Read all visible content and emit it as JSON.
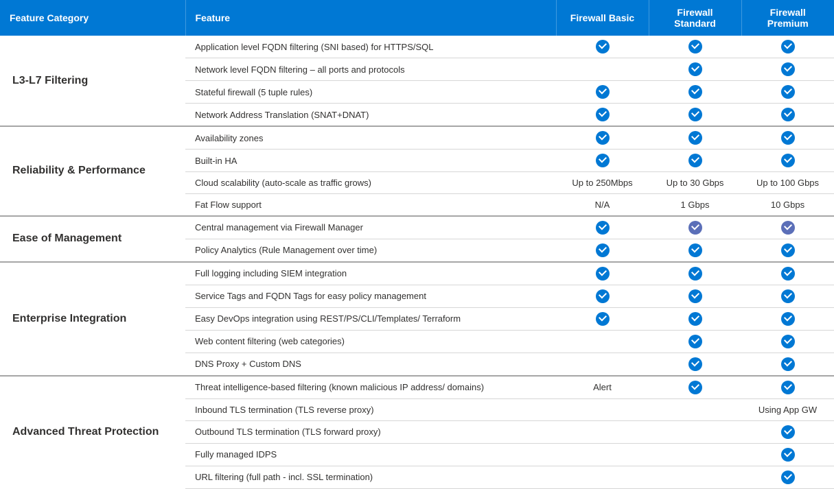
{
  "headers": {
    "category": "Feature Category",
    "feature": "Feature",
    "tiers": [
      "Firewall Basic",
      "Firewall Standard",
      "Firewall Premium"
    ]
  },
  "groups": [
    {
      "category": "L3-L7 Filtering",
      "rows": [
        {
          "feature": "Application level FQDN filtering (SNI based) for HTTPS/SQL",
          "cells": [
            {
              "t": "check"
            },
            {
              "t": "check"
            },
            {
              "t": "check"
            }
          ]
        },
        {
          "feature": "Network level FQDN filtering – all ports and protocols",
          "cells": [
            {
              "t": "blank"
            },
            {
              "t": "check"
            },
            {
              "t": "check"
            }
          ]
        },
        {
          "feature": "Stateful firewall (5 tuple rules)",
          "cells": [
            {
              "t": "check"
            },
            {
              "t": "check"
            },
            {
              "t": "check"
            }
          ]
        },
        {
          "feature": "Network Address Translation (SNAT+DNAT)",
          "cells": [
            {
              "t": "check"
            },
            {
              "t": "check"
            },
            {
              "t": "check"
            }
          ]
        }
      ]
    },
    {
      "category": "Reliability & Performance",
      "rows": [
        {
          "feature": "Availability zones",
          "cells": [
            {
              "t": "check"
            },
            {
              "t": "check"
            },
            {
              "t": "check"
            }
          ]
        },
        {
          "feature": "Built-in  HA",
          "cells": [
            {
              "t": "check"
            },
            {
              "t": "check"
            },
            {
              "t": "check"
            }
          ]
        },
        {
          "feature": "Cloud scalability (auto-scale as traffic grows)",
          "cells": [
            {
              "t": "text",
              "v": "Up to 250Mbps"
            },
            {
              "t": "text",
              "v": "Up to 30 Gbps"
            },
            {
              "t": "text",
              "v": "Up to 100 Gbps"
            }
          ]
        },
        {
          "feature": " Fat Flow support",
          "cells": [
            {
              "t": "text",
              "v": "N/A"
            },
            {
              "t": "text",
              "v": "1 Gbps"
            },
            {
              "t": "text",
              "v": "10 Gbps"
            }
          ]
        }
      ]
    },
    {
      "category": "Ease of Management",
      "rows": [
        {
          "feature": "Central management via Firewall Manager",
          "cells": [
            {
              "t": "check"
            },
            {
              "t": "check-muted"
            },
            {
              "t": "check-muted"
            }
          ]
        },
        {
          "feature": "Policy Analytics  (Rule Management over time)",
          "cells": [
            {
              "t": "check"
            },
            {
              "t": "check"
            },
            {
              "t": "check"
            }
          ]
        }
      ]
    },
    {
      "category": "Enterprise Integration",
      "rows": [
        {
          "feature": "Full logging including SIEM integration",
          "cells": [
            {
              "t": "check"
            },
            {
              "t": "check"
            },
            {
              "t": "check"
            }
          ]
        },
        {
          "feature": "Service Tags and FQDN Tags for easy policy management",
          "cells": [
            {
              "t": "check"
            },
            {
              "t": "check"
            },
            {
              "t": "check"
            }
          ]
        },
        {
          "feature": "Easy DevOps integration using REST/PS/CLI/Templates/ Terraform",
          "cells": [
            {
              "t": "check"
            },
            {
              "t": "check"
            },
            {
              "t": "check"
            }
          ]
        },
        {
          "feature": "Web content filtering (web categories)",
          "cells": [
            {
              "t": "blank"
            },
            {
              "t": "check"
            },
            {
              "t": "check"
            }
          ]
        },
        {
          "feature": "DNS Proxy + Custom DNS",
          "cells": [
            {
              "t": "blank"
            },
            {
              "t": "check"
            },
            {
              "t": "check"
            }
          ]
        }
      ]
    },
    {
      "category": "Advanced Threat Protection",
      "rows": [
        {
          "feature": "Threat intelligence-based filtering (known malicious IP address/ domains)",
          "cells": [
            {
              "t": "text",
              "v": "Alert"
            },
            {
              "t": "check"
            },
            {
              "t": "check"
            }
          ]
        },
        {
          "feature": "Inbound TLS termination (TLS reverse proxy)",
          "cells": [
            {
              "t": "blank"
            },
            {
              "t": "blank"
            },
            {
              "t": "text",
              "v": "Using App GW"
            }
          ]
        },
        {
          "feature": "Outbound TLS termination (TLS forward proxy)",
          "cells": [
            {
              "t": "blank"
            },
            {
              "t": "blank"
            },
            {
              "t": "check"
            }
          ]
        },
        {
          "feature": "Fully managed IDPS",
          "cells": [
            {
              "t": "blank"
            },
            {
              "t": "blank"
            },
            {
              "t": "check"
            }
          ]
        },
        {
          "feature": "URL filtering (full path - incl. SSL termination)",
          "cells": [
            {
              "t": "blank"
            },
            {
              "t": "blank"
            },
            {
              "t": "check"
            }
          ]
        }
      ]
    }
  ]
}
